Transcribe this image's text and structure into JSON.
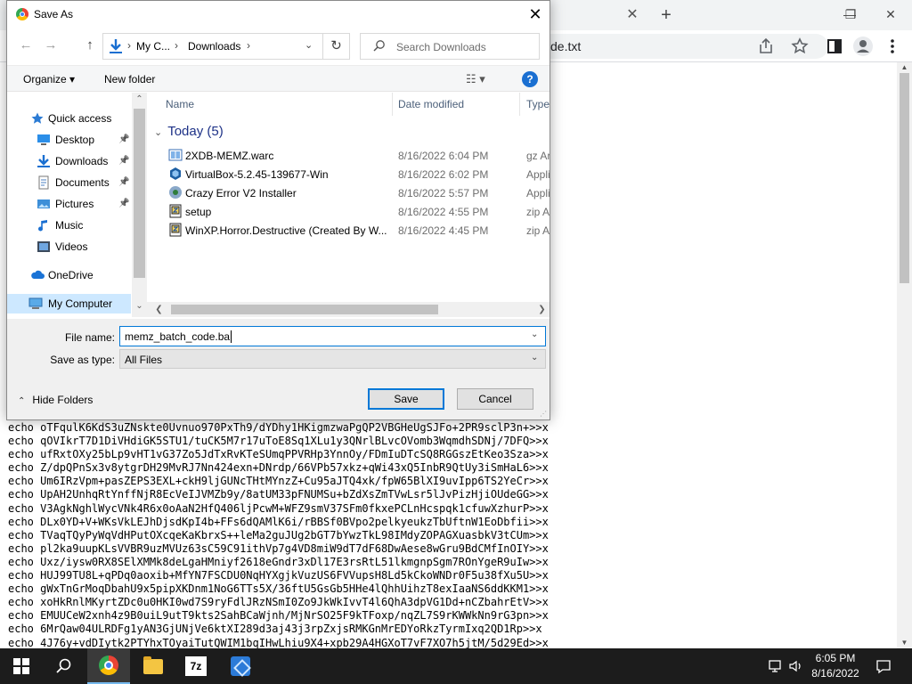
{
  "browser": {
    "tab_close": "✕",
    "new_tab": "+",
    "window_controls": {
      "minimize": "—",
      "restore": "❐",
      "close": "✕"
    },
    "omnibox_text": "de.txt",
    "toolbar_icons": [
      "share-icon",
      "star-icon",
      "side-panel-icon",
      "profile-icon",
      "menu-icon"
    ],
    "code_lines": [
      "echo oTFqulK6KdS3uZNskte0Uvnuo970PxTh9/dYDhy1HKigmzwaPgQP2VBGHeUgSJFo+2PR9sclP3n+>>x",
      "echo qOVIkrT7D1DiVHdiGK5STU1/tuCK5M7r17uToE8Sq1XLu1y3QNrlBLvcOVomb3WqmdhSDNj/7DFQ>>x",
      "echo ufRxtOXy25bLp9vHT1vG37Zo5JdTxRvKTeSUmqPPVRHp3YnnOy/FDmIuDTcSQ8RGGszEtKeo3Sza>>x",
      "echo Z/dpQPnSx3v8ytgrDH29MvRJ7Nn424exn+DNrdp/66VPb57xkz+qWi43xQ5InbR9QtUy3iSmHaL6>>x",
      "echo Um6IRzVpm+pasZEPS3EXL+ckH9ljGUNcTHtMYnzZ+Cu95aJTQ4xk/fpW65BlXI9uvIpp6TS2YeCr>>x",
      "echo UpAH2UnhqRtYnffNjR8EcVeIJVMZb9y/8atUM33pFNUMSu+bZdXsZmTVwLsr5lJvPizHjiOUdeGG>>x",
      "echo V3AgkNghlWycVNk4R6x0oAaN2HfQ406ljPcwM+WFZ9smV37SFm0fkxePCLnHcspqk1cfuwXzhurP>>x",
      "echo DLx0YD+V+WKsVkLEJhDjsdKpI4b+FFs6dQAMlK6i/rBBSf0BVpo2pelkyeukzTbUftnW1EoDbfii>>x",
      "echo TVaqTQyPyWqVdHPutOXcqeKaKbrxS++leMa2guJUg2bGT7bYwzTkL98IMdyZOPAGXuasbkV3tCUm>>x",
      "echo pl2ka9uupKLsVVBR9uzMVUz63sC59C91ithVp7g4VD8miW9dT7dF68DwAese8wGru9BdCMfInOIY>>x",
      "echo Uxz/iysw0RX8SElXMMk8deLgaHMniyf2618eGndr3xDl17E3rsRtL51lkmgnpSgm7ROnYgeR9uIw>>x",
      "echo HUJ99TU8L+qPDq0aoxib+MfYN7FSCDU0NqHYXgjkVuzUS6FVVupsH8Ld5kCkoWNDr0F5u38fXu5U>>x",
      "echo gWxTnGrMoqDbahU9x5pipXKDnm1NoG6TTs5X/36ftU5GsGb5HHe4lQhhUihzT8exIaaNS6ddKKM1>>x",
      "echo xoHkRnlMKyrtZDc0u0HKI0wd7S9ryFdlJRzNSmI0Zo9JkWkIvvT4l6QhA3dpVG1Dd+nCZbahrEtV>>x",
      "echo EMUUCeW2xnh4z9B0uiL9utT9kts2SahBCaWjnh/MjNrSO25F9kTFoxp/nqZL7S9rKWWkNn9rG3pn>>x",
      "echo 6MrQaw04ULRDFg1yAN3GjUNjVe6ktXI289d3aj43j3rpZxjsRMKGnMrEDYoRkzTyrmIxq2QD1Rp>>x",
      "echo 4J76y+vdDIytk2PTYhxTOyaiTutQWIM1bqIHwLhiu9X4+xpb29A4HGXoT7vF7XO7h5jtM/5d29Ed>>x"
    ]
  },
  "dialog": {
    "title": "Save As",
    "close_label": "✕",
    "nav": {
      "back": "←",
      "forward": "→",
      "up": "↑"
    },
    "address": {
      "crumbs": [
        "My C...",
        "Downloads"
      ],
      "sep": "›",
      "dropdown": "⌄"
    },
    "refresh": "↻",
    "search_placeholder": "Search Downloads",
    "commands": {
      "organize": "Organize ▾",
      "new_folder": "New folder",
      "view": "☷ ▾",
      "help": "?"
    },
    "nav_pane": [
      {
        "label": "Quick access",
        "icon": "star-icon",
        "pinned": false,
        "selected": false
      },
      {
        "label": "Desktop",
        "icon": "desktop-icon",
        "pinned": true,
        "selected": false
      },
      {
        "label": "Downloads",
        "icon": "download-icon",
        "pinned": true,
        "selected": false
      },
      {
        "label": "Documents",
        "icon": "documents-icon",
        "pinned": true,
        "selected": false
      },
      {
        "label": "Pictures",
        "icon": "pictures-icon",
        "pinned": true,
        "selected": false
      },
      {
        "label": "Music",
        "icon": "music-icon",
        "pinned": false,
        "selected": false
      },
      {
        "label": "Videos",
        "icon": "videos-icon",
        "pinned": false,
        "selected": false
      },
      {
        "label": "OneDrive",
        "icon": "cloud-icon",
        "pinned": false,
        "selected": false
      },
      {
        "label": "My Computer",
        "icon": "computer-icon",
        "pinned": false,
        "selected": true
      }
    ],
    "columns": {
      "name": "Name",
      "date": "Date modified",
      "type": "Type"
    },
    "group": {
      "label": "Today (5)"
    },
    "files": [
      {
        "name": "2XDB-MEMZ.warc",
        "date": "8/16/2022 6:04 PM",
        "type": "gz Ar",
        "icon": "archive-icon"
      },
      {
        "name": "VirtualBox-5.2.45-139677-Win",
        "date": "8/16/2022 6:02 PM",
        "type": "Appli",
        "icon": "virtualbox-icon"
      },
      {
        "name": "Crazy Error V2 Installer",
        "date": "8/16/2022 5:57 PM",
        "type": "Appli",
        "icon": "installer-icon"
      },
      {
        "name": "setup",
        "date": "8/16/2022 4:55 PM",
        "type": "zip A",
        "icon": "zip-icon"
      },
      {
        "name": "WinXP.Horror.Destructive  (Created By W...",
        "date": "8/16/2022 4:45 PM",
        "type": "zip A",
        "icon": "zip-icon"
      }
    ],
    "file_name_label": "File name:",
    "file_name_value": "memz_batch_code.ba",
    "save_as_type_label": "Save as type:",
    "save_as_type_value": "All Files",
    "hide_folders": "Hide Folders",
    "save_button": "Save",
    "cancel_button": "Cancel"
  },
  "taskbar": {
    "apps": [
      "start-icon",
      "search-icon",
      "chrome-icon",
      "file-explorer-icon",
      "7zip-icon",
      "app-icon"
    ],
    "sevenzip_label": "7z",
    "time": "6:05 PM",
    "date": "8/16/2022"
  }
}
